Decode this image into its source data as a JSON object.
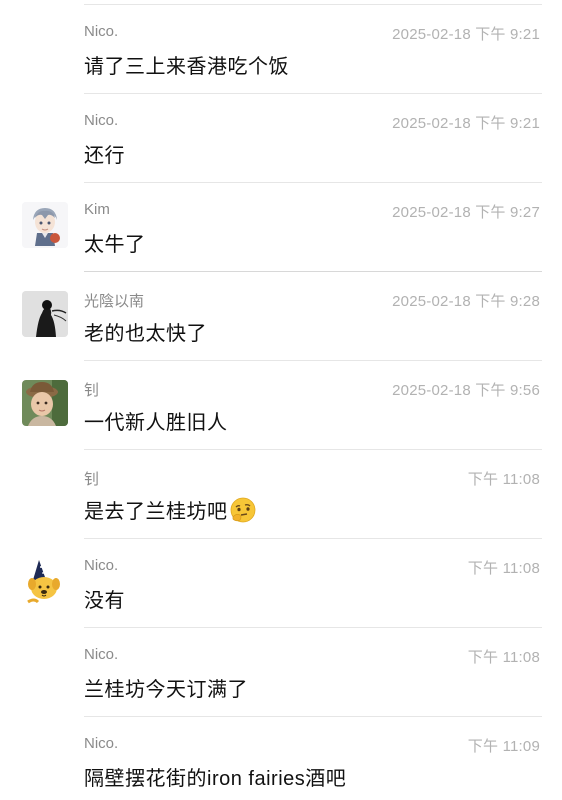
{
  "messages": [
    {
      "name": "Nico.",
      "time": "2025-02-18 下午 9:21",
      "text": "请了三上来香港吃个饭",
      "avatar": "none"
    },
    {
      "name": "Nico.",
      "time": "2025-02-18 下午 9:21",
      "text": "还行",
      "avatar": "none"
    },
    {
      "name": "Kim",
      "time": "2025-02-18 下午 9:27",
      "text": "太牛了",
      "avatar": "anime-character-avatar"
    },
    {
      "name": "光陰以南",
      "time": "2025-02-18 下午 9:28",
      "text": "老的也太快了",
      "avatar": "ink-painting-avatar"
    },
    {
      "name": "钊",
      "time": "2025-02-18 下午 9:56",
      "text": "一代新人胜旧人",
      "avatar": "child-with-hat-avatar"
    },
    {
      "name": "钊",
      "time": "下午 11:08",
      "text": "是去了兰桂坊吧",
      "avatar": "none",
      "emoji": "thinking-face-emoji"
    },
    {
      "name": "Nico.",
      "time": "下午 11:08",
      "text": "没有",
      "avatar": "cartoon-dog-wizard-avatar"
    },
    {
      "name": "Nico.",
      "time": "下午 11:08",
      "text": "兰桂坊今天订满了",
      "avatar": "none"
    },
    {
      "name": "Nico.",
      "time": "下午 11:09",
      "text": "隔壁摆花街的iron fairies酒吧",
      "avatar": "none"
    }
  ]
}
